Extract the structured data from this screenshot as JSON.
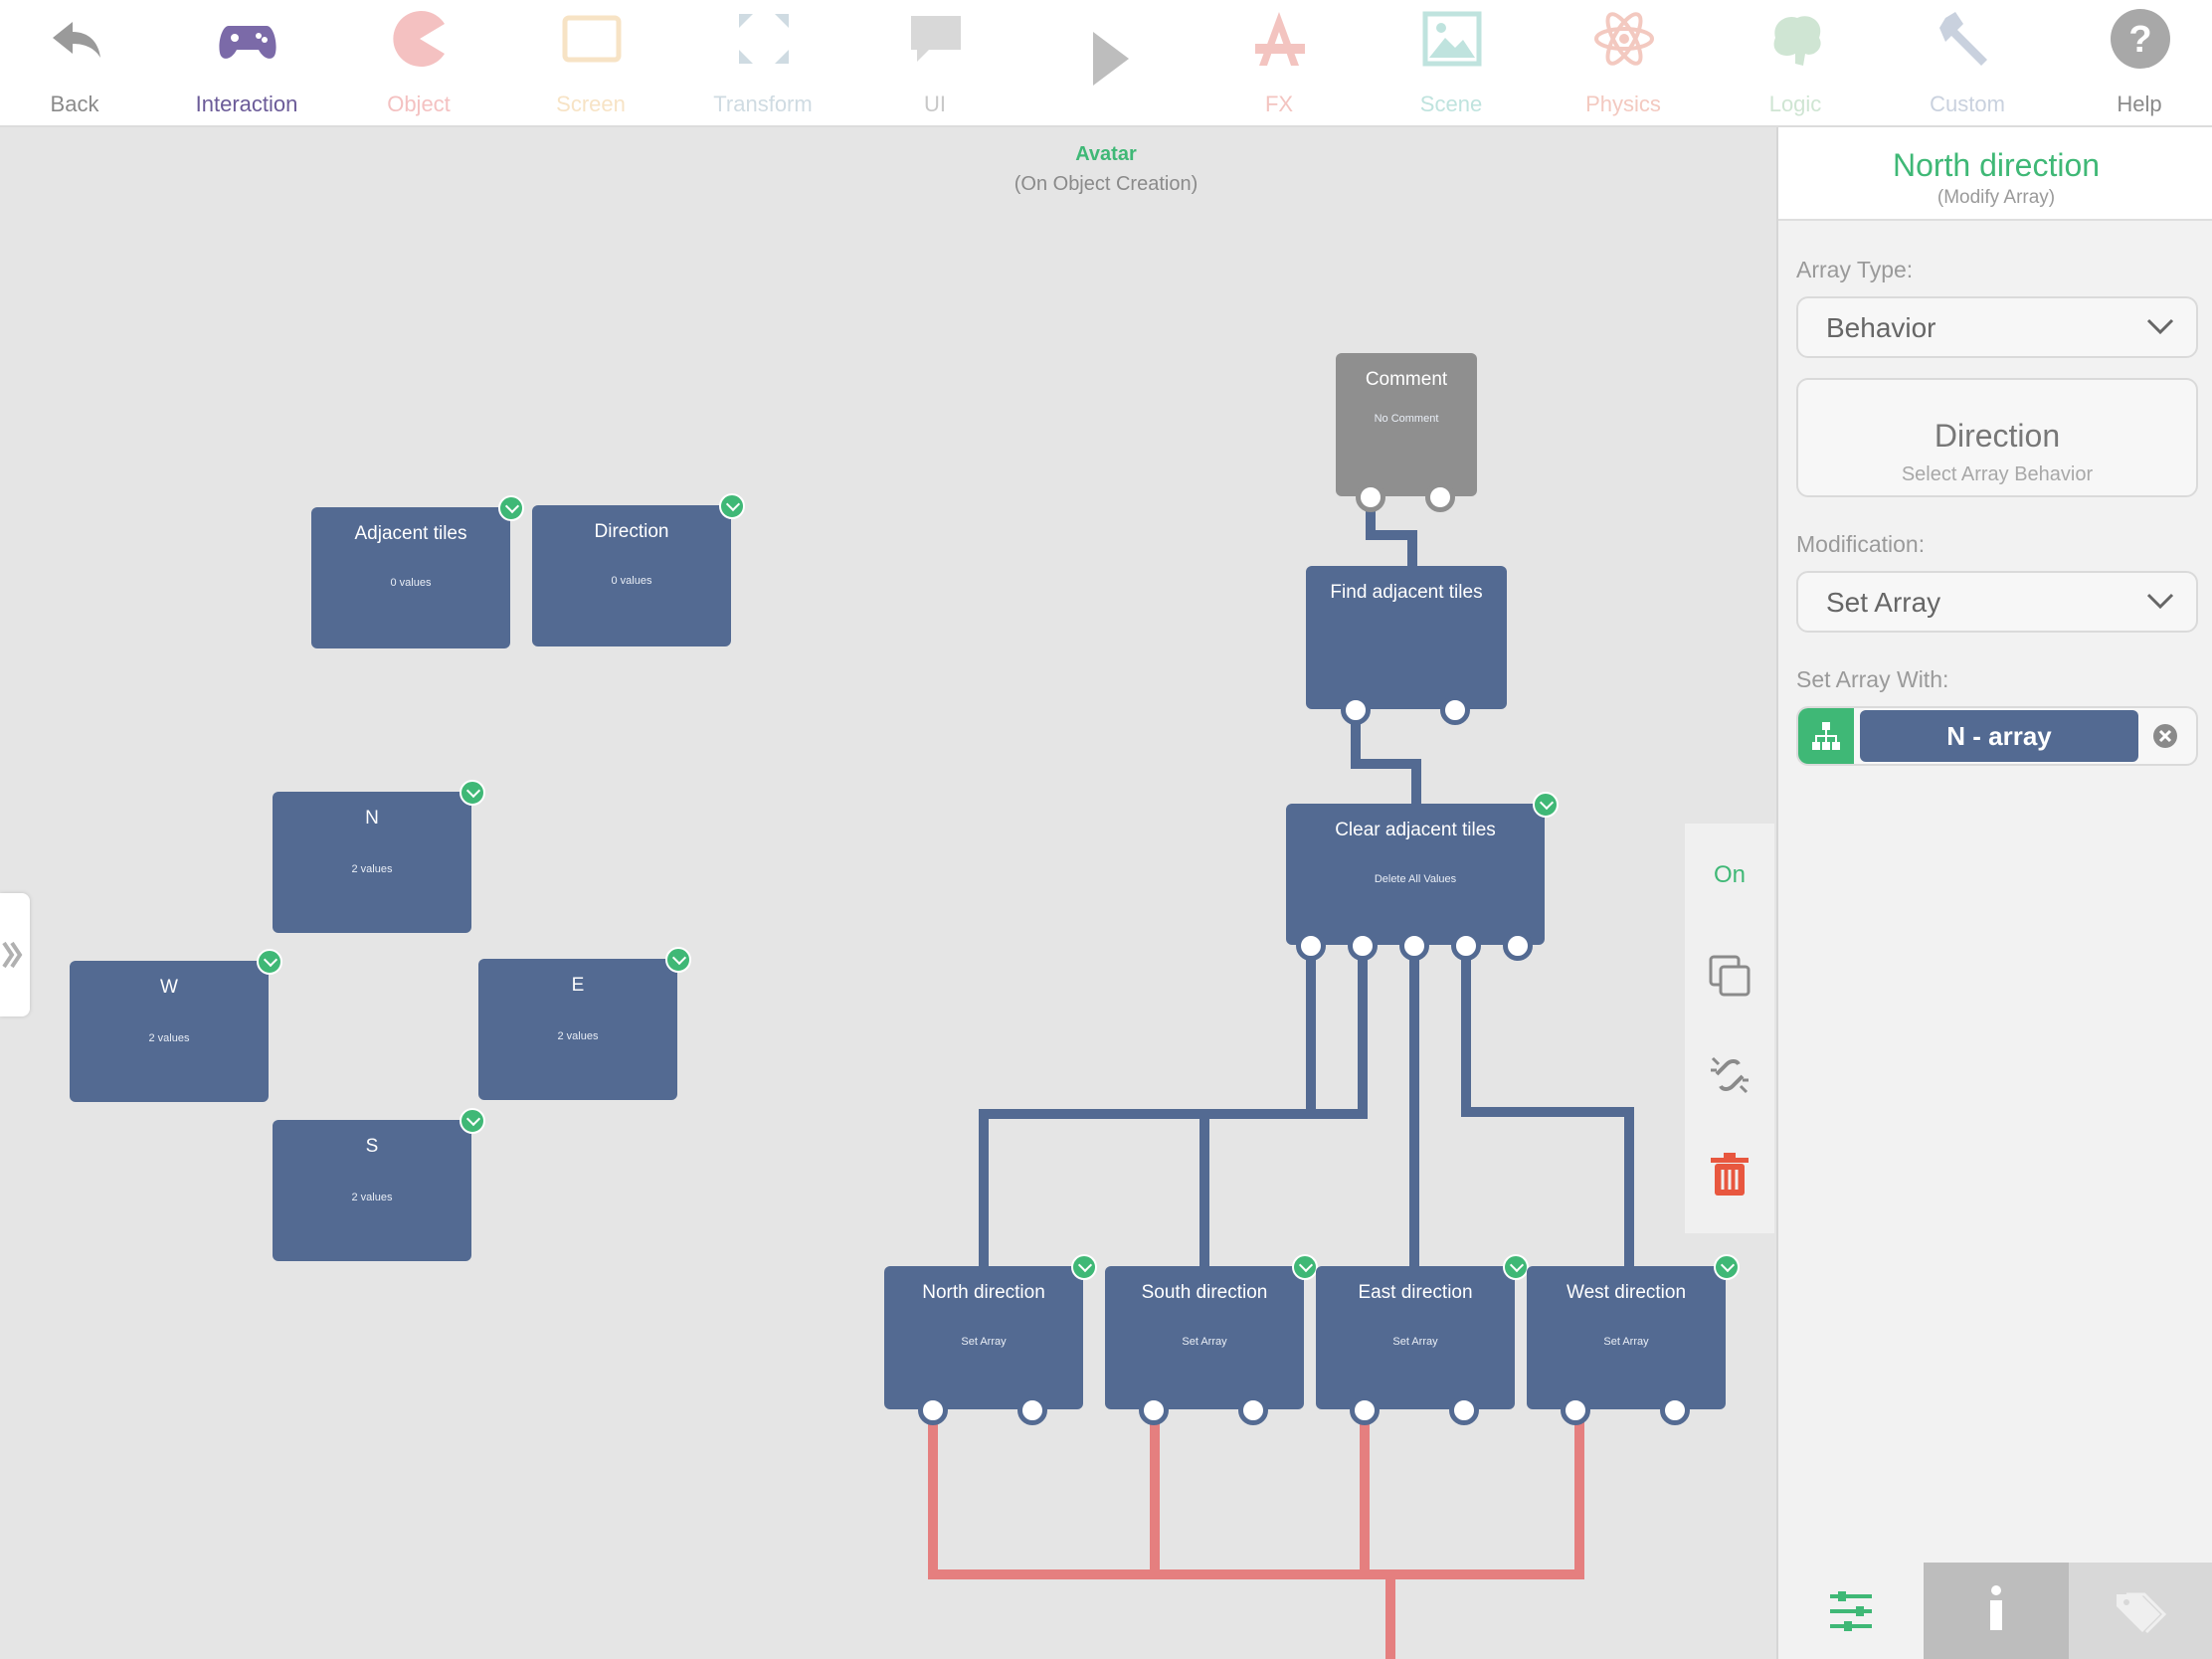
{
  "toolbar": {
    "items": [
      {
        "label": "Back",
        "icon": "back-arrow-icon",
        "color": "#9a9a9a"
      },
      {
        "label": "Interaction",
        "icon": "gamepad-icon",
        "color": "#7b6aa8"
      },
      {
        "label": "Object",
        "icon": "pacman-icon",
        "color": "#f4c1c1"
      },
      {
        "label": "Screen",
        "icon": "screen-icon",
        "color": "#f7e3c5"
      },
      {
        "label": "Transform",
        "icon": "transform-icon",
        "color": "#cfdbe2"
      },
      {
        "label": "UI",
        "icon": "speech-bubble-icon",
        "color": "#d8d8d8"
      },
      {
        "label": "",
        "icon": "play-icon",
        "color": "#bdbdbd"
      },
      {
        "label": "FX",
        "icon": "fx-icon",
        "color": "#f3c4c0"
      },
      {
        "label": "Scene",
        "icon": "scene-image-icon",
        "color": "#bfe3de"
      },
      {
        "label": "Physics",
        "icon": "atom-icon",
        "color": "#f3c9c0"
      },
      {
        "label": "Logic",
        "icon": "brain-icon",
        "color": "#cfe5d3"
      },
      {
        "label": "Custom",
        "icon": "wrench-icon",
        "color": "#c9d1de"
      },
      {
        "label": "Help",
        "icon": "help-icon",
        "color": "#a8a8a8"
      }
    ]
  },
  "canvas": {
    "title": "Avatar",
    "subtitle": "(On Object Creation)",
    "nodes": {
      "comment": {
        "title": "Comment",
        "sub": "No Comment"
      },
      "adjacent_tiles": {
        "title": "Adjacent tiles",
        "sub": "0 values"
      },
      "direction": {
        "title": "Direction",
        "sub": "0 values"
      },
      "n": {
        "title": "N",
        "sub": "2 values"
      },
      "w": {
        "title": "W",
        "sub": "2 values"
      },
      "e": {
        "title": "E",
        "sub": "2 values"
      },
      "s": {
        "title": "S",
        "sub": "2 values"
      },
      "find": {
        "title": "Find adjacent tiles",
        "sub": ""
      },
      "clear": {
        "title": "Clear adjacent tiles",
        "sub": "Delete All Values"
      },
      "north": {
        "title": "North direction",
        "sub": "Set Array"
      },
      "south": {
        "title": "South direction",
        "sub": "Set Array"
      },
      "east": {
        "title": "East direction",
        "sub": "Set Array"
      },
      "west": {
        "title": "West direction",
        "sub": "Set Array"
      }
    },
    "wire_colors": {
      "blue": "#536a92",
      "red": "#e57f7f"
    }
  },
  "actions": {
    "toggle_label": "On",
    "toggle_color": "#3fb876",
    "icons": [
      "duplicate-icon",
      "unlink-icon",
      "trash-icon"
    ],
    "trash_color": "#e8573f"
  },
  "panel": {
    "title": "North direction",
    "subtitle": "(Modify Array)",
    "array_type_label": "Array Type:",
    "array_type_value": "Behavior",
    "behavior_title": "Direction",
    "behavior_sub": "Select Array Behavior",
    "modification_label": "Modification:",
    "modification_value": "Set Array",
    "set_with_label": "Set Array With:",
    "set_with_value": "N - array",
    "tabs": [
      "sliders-icon",
      "info-icon",
      "tag-icon"
    ]
  },
  "colors": {
    "accent": "#3fb876",
    "node": "#536a92"
  }
}
